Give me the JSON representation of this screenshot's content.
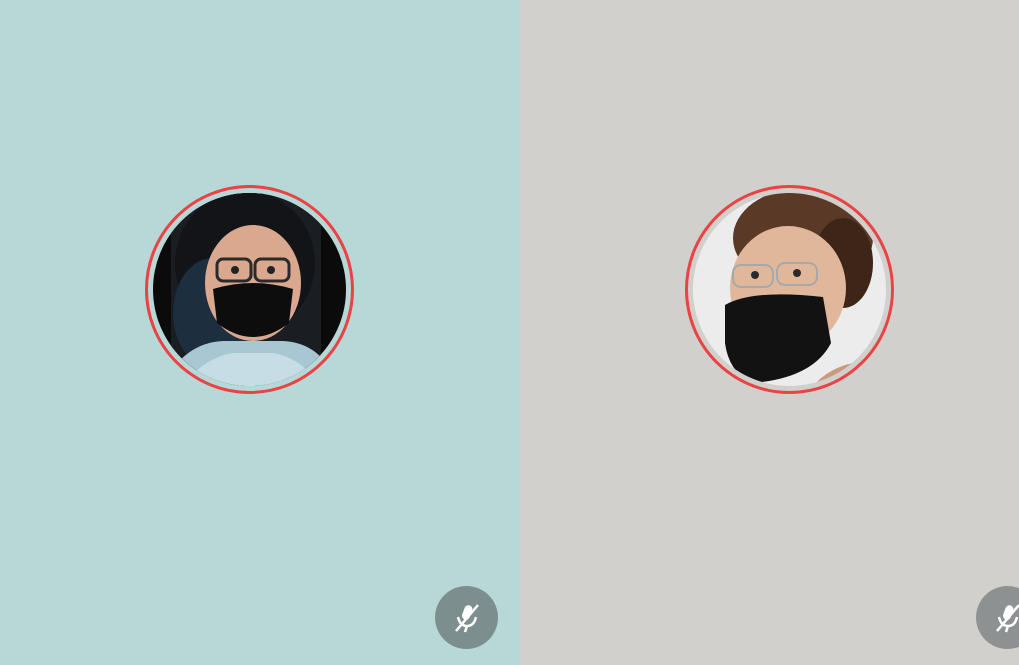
{
  "participants": [
    {
      "id": "participant-1",
      "tile_color": "#b8d8d8",
      "ring_color": "#e94343",
      "muted": true,
      "mic_icon": "mic-off-icon"
    },
    {
      "id": "participant-2",
      "tile_color": "#d1d0cd",
      "ring_color": "#e94343",
      "muted": true,
      "mic_icon": "mic-off-icon"
    }
  ]
}
